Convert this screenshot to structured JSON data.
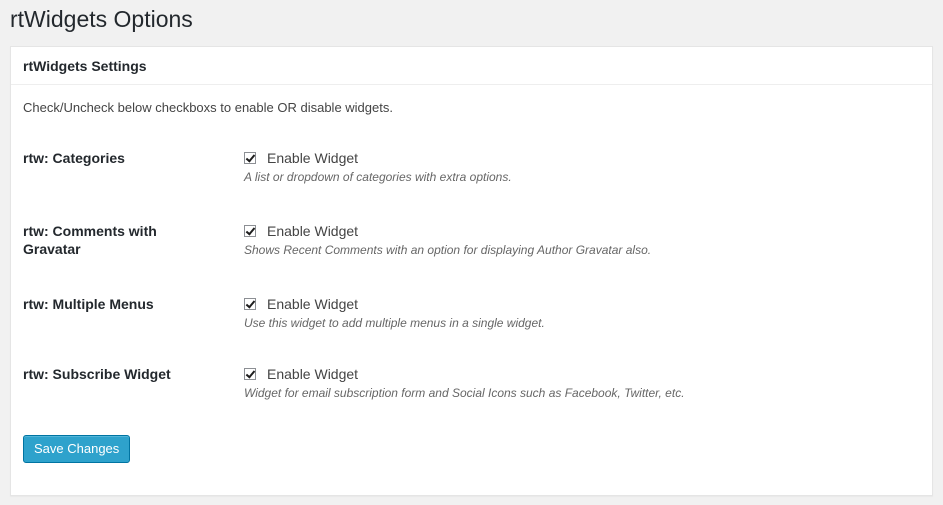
{
  "page": {
    "title": "rtWidgets Options"
  },
  "panel": {
    "title": "rtWidgets Settings",
    "intro": "Check/Uncheck below checkboxs to enable OR disable widgets."
  },
  "widgets": [
    {
      "label": "rtw: Categories",
      "checkbox_label": "Enable Widget",
      "checked": true,
      "description": "A list or dropdown of categories with extra options."
    },
    {
      "label": "rtw: Comments with Gravatar",
      "checkbox_label": "Enable Widget",
      "checked": true,
      "description": "Shows Recent Comments with an option for displaying Author Gravatar also."
    },
    {
      "label": "rtw: Multiple Menus",
      "checkbox_label": "Enable Widget",
      "checked": true,
      "description": "Use this widget to add multiple menus in a single widget."
    },
    {
      "label": "rtw: Subscribe Widget",
      "checkbox_label": "Enable Widget",
      "checked": true,
      "description": "Widget for email subscription form and Social Icons such as Facebook, Twitter, etc."
    }
  ],
  "actions": {
    "save_label": "Save Changes"
  },
  "colors": {
    "primary_button": "#2ea2cc",
    "background": "#f1f1f1"
  }
}
